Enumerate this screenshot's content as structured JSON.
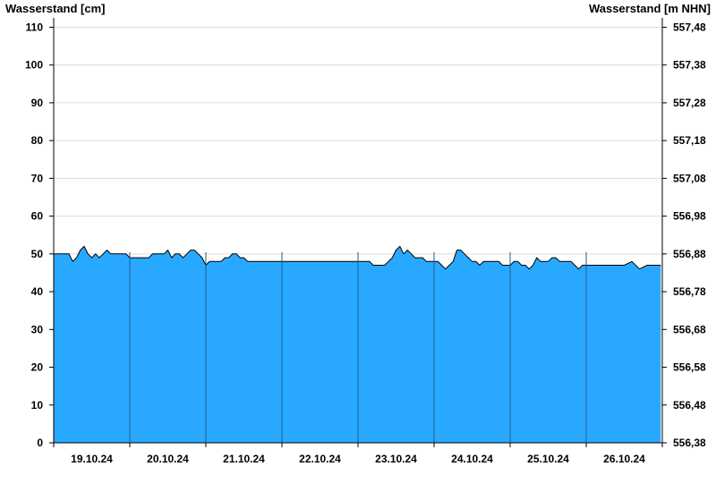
{
  "chart_data": {
    "type": "area",
    "ylabel_left": "Wasserstand [cm]",
    "ylabel_right": "Wasserstand [m NHN]",
    "ylim": [
      0,
      112
    ],
    "yticks_left": [
      0,
      10,
      20,
      30,
      40,
      50,
      60,
      70,
      80,
      90,
      100,
      110
    ],
    "yticks_right": [
      "556,38",
      "556,48",
      "556,58",
      "556,68",
      "556,78",
      "556,88",
      "556,98",
      "557,08",
      "557,18",
      "557,28",
      "557,38",
      "557,48"
    ],
    "x_categories": [
      "19.10.24",
      "20.10.24",
      "21.10.24",
      "22.10.24",
      "23.10.24",
      "24.10.24",
      "25.10.24",
      "26.10.24"
    ],
    "grid": true,
    "fill_color": "#29A8FF",
    "line_color": "#000000",
    "series": [
      {
        "x": [
          0.0,
          0.08,
          0.15,
          0.2,
          0.25,
          0.3,
          0.35,
          0.4,
          0.45,
          0.5,
          0.55,
          0.6,
          0.65,
          0.7,
          0.75,
          0.8,
          0.85,
          0.9,
          0.95,
          1.0,
          1.05,
          1.1,
          1.15,
          1.2,
          1.25,
          1.3,
          1.35,
          1.4,
          1.45,
          1.5,
          1.55,
          1.6,
          1.65,
          1.7,
          1.75,
          1.8,
          1.85,
          1.9,
          1.95,
          2.0,
          2.05,
          2.1,
          2.15,
          2.2,
          2.25,
          2.3,
          2.35,
          2.4,
          2.45,
          2.5,
          2.55,
          2.6,
          2.65,
          2.7,
          2.75,
          2.8,
          2.85,
          2.9,
          2.95,
          3.0,
          3.1,
          3.2,
          3.3,
          3.4,
          3.5,
          3.6,
          3.7,
          3.8,
          3.9,
          4.0,
          4.05,
          4.1,
          4.15,
          4.2,
          4.25,
          4.3,
          4.35,
          4.4,
          4.45,
          4.5,
          4.55,
          4.6,
          4.65,
          4.7,
          4.75,
          4.8,
          4.85,
          4.9,
          4.95,
          5.0,
          5.05,
          5.1,
          5.15,
          5.2,
          5.25,
          5.3,
          5.35,
          5.4,
          5.45,
          5.5,
          5.55,
          5.6,
          5.65,
          5.7,
          5.75,
          5.8,
          5.85,
          5.9,
          5.95,
          6.0,
          6.05,
          6.1,
          6.15,
          6.2,
          6.25,
          6.3,
          6.35,
          6.4,
          6.45,
          6.5,
          6.55,
          6.6,
          6.65,
          6.7,
          6.75,
          6.8,
          6.85,
          6.9,
          6.95,
          7.0,
          7.1,
          7.2,
          7.3,
          7.4,
          7.5,
          7.6,
          7.7,
          7.8,
          7.98
        ],
        "y": [
          50,
          50,
          50,
          50,
          48,
          49,
          51,
          52,
          50,
          49,
          50,
          49,
          50,
          51,
          50,
          50,
          50,
          50,
          50,
          49,
          49,
          49,
          49,
          49,
          49,
          50,
          50,
          50,
          50,
          51,
          49,
          50,
          50,
          49,
          50,
          51,
          51,
          50,
          49,
          47,
          48,
          48,
          48,
          48,
          49,
          49,
          50,
          50,
          49,
          49,
          48,
          48,
          48,
          48,
          48,
          48,
          48,
          48,
          48,
          48,
          48,
          48,
          48,
          48,
          48,
          48,
          48,
          48,
          48,
          48,
          48,
          48,
          48,
          47,
          47,
          47,
          47,
          48,
          49,
          51,
          52,
          50,
          51,
          50,
          49,
          49,
          49,
          48,
          48,
          48,
          48,
          47,
          46,
          47,
          48,
          51,
          51,
          50,
          49,
          48,
          48,
          47,
          48,
          48,
          48,
          48,
          48,
          47,
          47,
          47,
          48,
          48,
          47,
          47,
          46,
          47,
          49,
          48,
          48,
          48,
          49,
          49,
          48,
          48,
          48,
          48,
          47,
          46,
          47,
          47,
          47,
          47,
          47,
          47,
          47,
          48,
          46,
          47,
          47
        ]
      }
    ]
  }
}
